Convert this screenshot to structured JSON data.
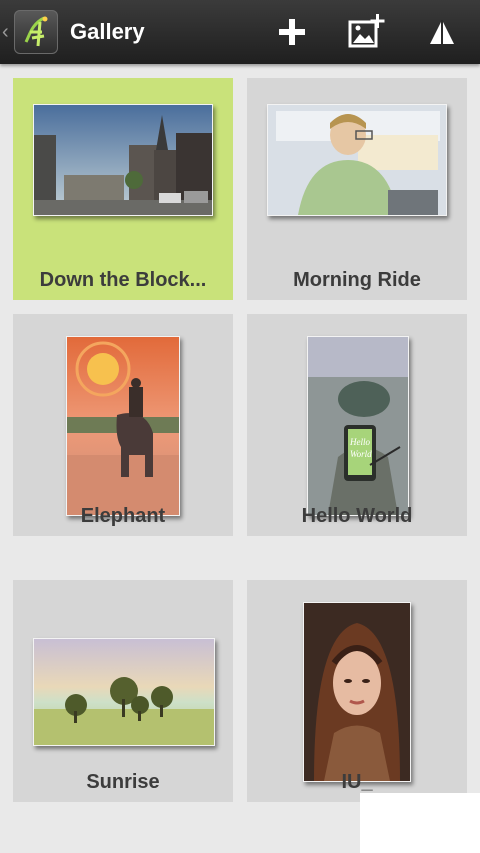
{
  "app": {
    "title": "Gallery"
  },
  "actions": {
    "add": "add-icon",
    "import": "add-image-icon",
    "more": "overflow-triangle-icon"
  },
  "artworks": [
    {
      "title": "Down the Block...",
      "selected": true
    },
    {
      "title": "Morning Ride",
      "selected": false
    },
    {
      "title": "Elephant",
      "selected": false
    },
    {
      "title": "Hello World",
      "selected": false
    },
    {
      "title": "Sunrise",
      "selected": false
    },
    {
      "title": "IU_",
      "selected": false
    }
  ],
  "colors": {
    "actionbar": "#2a2a2a",
    "selected_tile": "#c9e27a",
    "tile": "#d6d6d6",
    "background": "#e9e9e9"
  }
}
